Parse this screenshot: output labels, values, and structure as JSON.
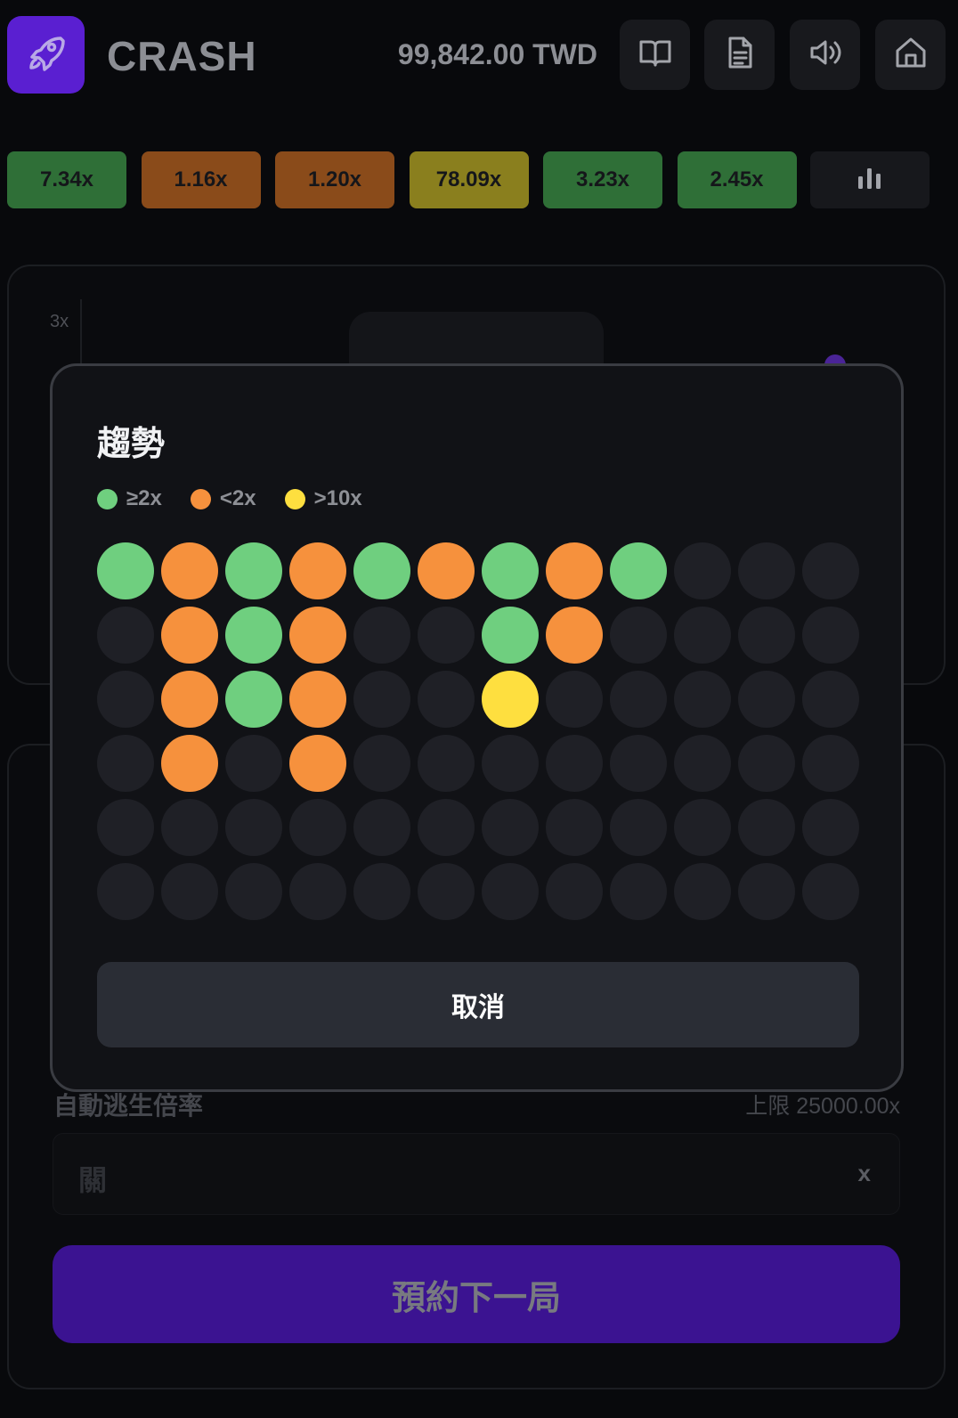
{
  "header": {
    "title": "CRASH",
    "balance": "99,842.00 TWD",
    "icons": [
      "rocket-icon",
      "book-icon",
      "document-icon",
      "volume-icon",
      "home-icon"
    ]
  },
  "history": [
    {
      "label": "7.34x",
      "color": "green"
    },
    {
      "label": "1.16x",
      "color": "orange"
    },
    {
      "label": "1.20x",
      "color": "orange"
    },
    {
      "label": "78.09x",
      "color": "yellow"
    },
    {
      "label": "3.23x",
      "color": "green"
    },
    {
      "label": "2.45x",
      "color": "green"
    }
  ],
  "graph": {
    "axis_label": "3x"
  },
  "bet_panel": {
    "auto_label": "自動逃生倍率",
    "auto_limit": "上限 25000.00x",
    "auto_value": "關",
    "auto_suffix": "x",
    "reserve_label": "預約下一局"
  },
  "modal": {
    "title": "趨勢",
    "legend": [
      {
        "label": "≥2x",
        "color": "#6fcf7f"
      },
      {
        "label": "<2x",
        "color": "#f6913d"
      },
      {
        "label": ">10x",
        "color": "#fedf3f"
      }
    ],
    "colors": {
      "g": "#6fcf7f",
      "o": "#f6913d",
      "y": "#fedf3f",
      "empty": "#1f2026"
    },
    "trend_grid": [
      [
        "g",
        "o",
        "g",
        "o",
        "g",
        "o",
        "g",
        "o",
        "g",
        "",
        "",
        ""
      ],
      [
        "",
        "o",
        "g",
        "o",
        "",
        "",
        "g",
        "o",
        "",
        "",
        "",
        ""
      ],
      [
        "",
        "o",
        "g",
        "o",
        "",
        "",
        "y",
        "",
        "",
        "",
        "",
        ""
      ],
      [
        "",
        "o",
        "",
        "o",
        "",
        "",
        "",
        "",
        "",
        "",
        "",
        ""
      ],
      [
        "",
        "",
        "",
        "",
        "",
        "",
        "",
        "",
        "",
        "",
        "",
        ""
      ],
      [
        "",
        "",
        "",
        "",
        "",
        "",
        "",
        "",
        "",
        "",
        "",
        ""
      ]
    ],
    "cancel_label": "取消"
  }
}
